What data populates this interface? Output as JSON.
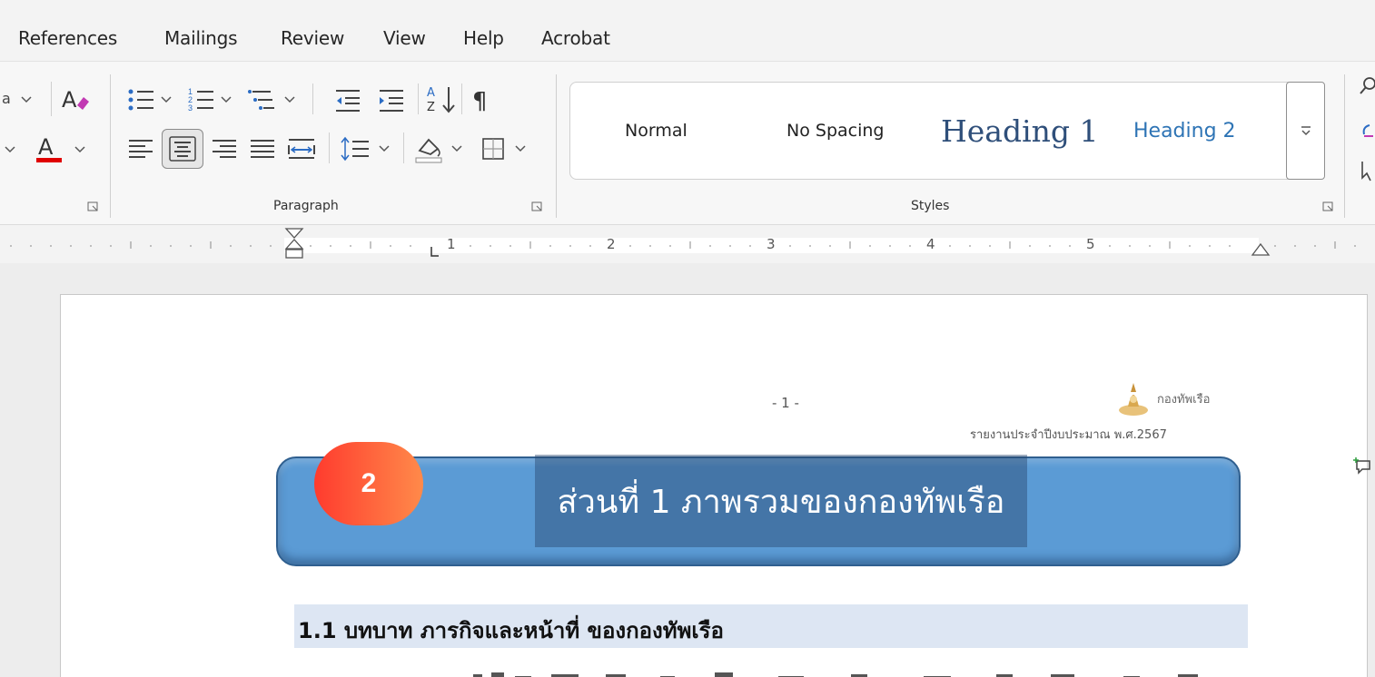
{
  "menu": {
    "tabs": [
      "References",
      "Mailings",
      "Review",
      "View",
      "Help",
      "Acrobat"
    ]
  },
  "ribbon": {
    "groups": {
      "paragraph": "Paragraph",
      "styles": "Styles"
    },
    "styles_gallery": {
      "items": [
        "Normal",
        "No Spacing",
        "Heading 1",
        "Heading 2"
      ],
      "heading1_visible": "Heading"
    },
    "icons": {
      "bullets": "bullets-icon",
      "numbering": "numbering-icon",
      "multilevel": "multilevel-list-icon",
      "decrease_indent": "decrease-indent-icon",
      "increase_indent": "increase-indent-icon",
      "sort": "sort-icon",
      "show_marks": "pilcrow-icon",
      "align_left": "align-left-icon",
      "align_center": "align-center-icon",
      "align_right": "align-right-icon",
      "justify": "justify-icon",
      "distributed": "distributed-icon",
      "line_spacing": "line-spacing-icon",
      "shading": "shading-icon",
      "borders": "borders-icon",
      "font_color": "font-color-icon",
      "clear_format": "clear-formatting-icon",
      "find": "find-icon",
      "replace": "replace-icon",
      "select": "select-icon"
    },
    "colors": {
      "font_color_bar": "#e00000",
      "clear_format_accent": "#c239b3"
    }
  },
  "ruler": {
    "numbers": [
      "1",
      "2",
      "3",
      "4",
      "5"
    ]
  },
  "document": {
    "page_number": "- 1 -",
    "org_name": "กองทัพเรือ",
    "report_line": "รายงานประจำปีงบประมาณ พ.ศ.2567",
    "banner_title": "ส่วนที่ 1 ภาพรวมของกองทัพเรือ",
    "step_badge": "2",
    "section_heading": "1.1  บทบาท ภารกิจและหน้าที่ ของกองทัพเรือ",
    "colors": {
      "banner": "#5b9bd5",
      "badge_start": "#ff3b2e",
      "badge_end": "#ff8a4a",
      "section_bg": "#dde6f3"
    }
  }
}
